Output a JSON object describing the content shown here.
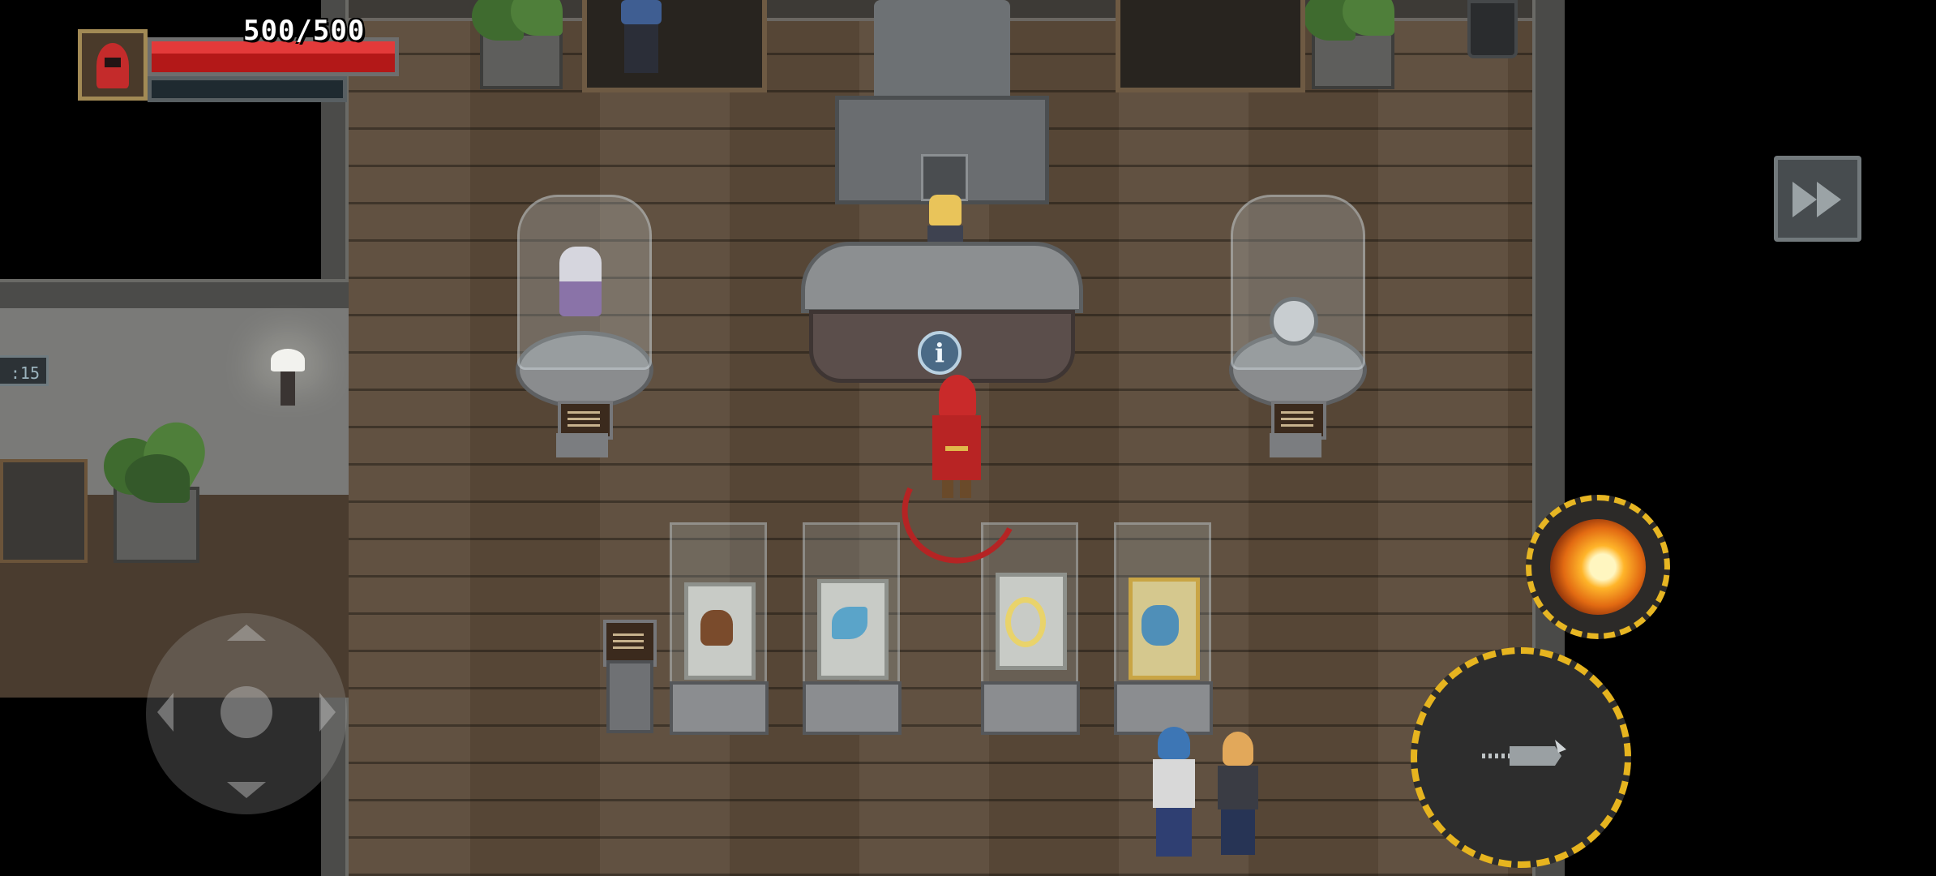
{
  "hud": {
    "hp_text": "500/500",
    "hp_current": 500,
    "hp_max": 500,
    "mana_fraction": 0,
    "portrait_icon": "red-hooded-hero-icon"
  },
  "controls": {
    "fast_forward_icon": "fast-forward-icon",
    "joystick_icon": "dpad-joystick-icon",
    "skill_dash_icon": "fire-dash-skill-icon",
    "attack_icon": "slash-attack-icon"
  },
  "scene": {
    "clock_text": ":15",
    "info_icon": "info-icon",
    "display_case_icons": [
      "gauntlets-relic-icon",
      "frost-bird-relic-icon",
      "golden-rings-relic-icon",
      "blue-fist-relic-icon"
    ],
    "pedestal_left_icon": "armor-relic-icon",
    "pedestal_right_icon": "orb-relic-icon"
  },
  "colors": {
    "hp": "#d42a2a",
    "skill_ring": "#e6b41f",
    "floor": "#5b4a39"
  }
}
